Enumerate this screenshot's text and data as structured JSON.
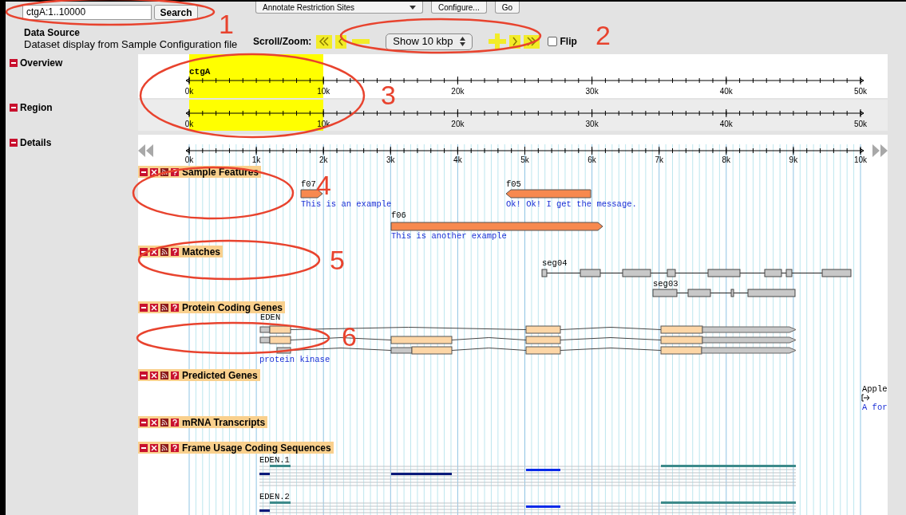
{
  "search": {
    "value": "ctgA:1..10000",
    "button": "Search"
  },
  "plugin": {
    "selected": "Annotate Restriction Sites",
    "configure_button": "Configure...",
    "go_button": "Go"
  },
  "data_source": {
    "title": "Data Source",
    "description": "Dataset display from Sample Configuration file"
  },
  "scroll_zoom": {
    "label": "Scroll/Zoom:",
    "zoom": "Show 10 kbp",
    "flip": {
      "label": "Flip",
      "checked": false
    }
  },
  "overview": {
    "title": "Overview",
    "chromosome": "ctgA",
    "ticks": [
      "0k",
      "10k",
      "20k",
      "30k",
      "40k",
      "50k"
    ]
  },
  "region": {
    "title": "Region",
    "ticks": [
      "0k",
      "10k",
      "20k",
      "30k",
      "40k",
      "50k"
    ]
  },
  "details": {
    "title": "Details",
    "ticks": [
      "0k",
      "1k",
      "2k",
      "3k",
      "4k",
      "5k",
      "6k",
      "7k",
      "8k",
      "9k",
      "10k"
    ],
    "tracks": [
      {
        "title": "Sample Features",
        "features": [
          {
            "kind": "arrow",
            "name": "f07",
            "description": "This is an example"
          },
          {
            "kind": "arrow",
            "name": "f05",
            "description": "Ok! Ok! I get the message."
          },
          {
            "kind": "arrow",
            "name": "f06",
            "description": "This is another example"
          }
        ]
      },
      {
        "title": "Matches",
        "features": [
          {
            "kind": "segments",
            "name": "seg04"
          },
          {
            "kind": "segments",
            "name": "seg03"
          }
        ]
      },
      {
        "title": "Protein Coding Genes",
        "features": [
          {
            "kind": "gene",
            "name": "EDEN",
            "description": "protein kinase"
          }
        ]
      },
      {
        "title": "Predicted Genes",
        "features": [
          {
            "kind": "gene_stub",
            "name": "Apple",
            "description": "A for"
          }
        ]
      },
      {
        "title": "mRNA Transcripts"
      },
      {
        "title": "Frame Usage Coding Sequences",
        "features": [
          {
            "kind": "frames",
            "name": "EDEN.1"
          },
          {
            "kind": "frames",
            "name": "EDEN.2"
          }
        ]
      }
    ]
  },
  "annotations": [
    "1",
    "2",
    "3",
    "4",
    "5",
    "6"
  ]
}
